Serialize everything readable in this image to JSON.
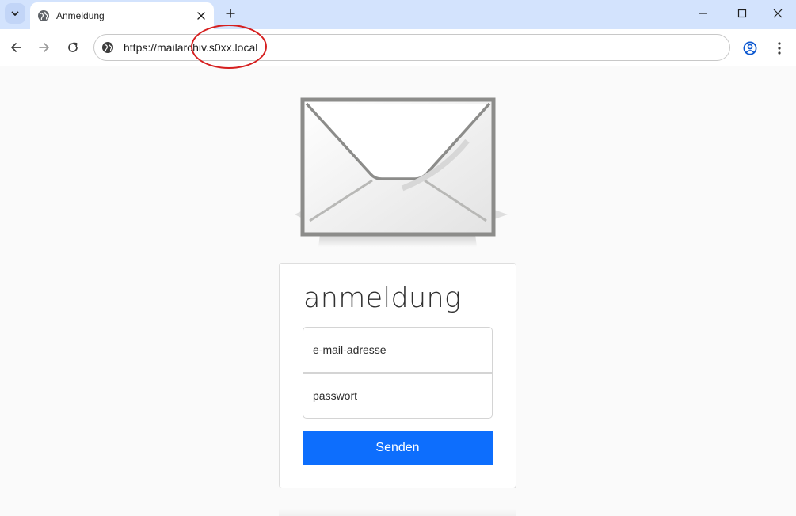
{
  "browser": {
    "tab": {
      "title": "Anmeldung"
    },
    "address_bar": {
      "url": "https://mailarchiv.s0xx.local"
    }
  },
  "login": {
    "heading": "anmeldung",
    "email_placeholder": "e-mail-adresse",
    "password_placeholder": "passwort",
    "submit_label": "Senden"
  },
  "colors": {
    "tabstrip": "#d3e3fd",
    "primary_button": "#0d6efd",
    "annotation": "#d61f1f"
  },
  "icons": {
    "tab_search": "chevron-down-icon",
    "favicon": "globe-icon",
    "tab_close": "close-icon",
    "new_tab": "plus-icon",
    "back": "arrow-left-icon",
    "forward": "arrow-right-icon",
    "reload": "reload-icon",
    "site_info": "globe-icon",
    "profile": "profile-icon",
    "menu": "kebab-menu-icon",
    "logo": "envelope-icon"
  }
}
